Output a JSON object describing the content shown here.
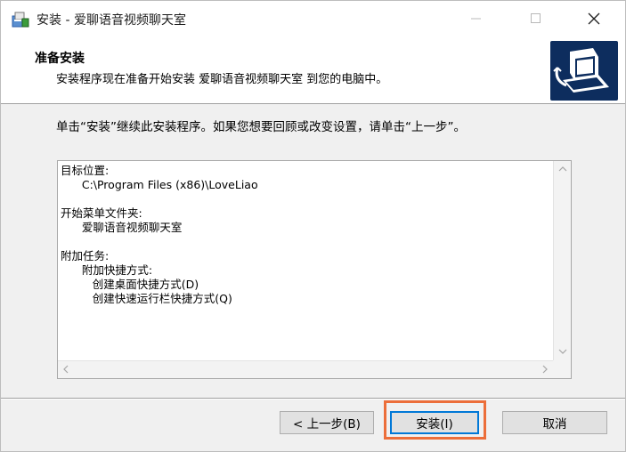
{
  "window": {
    "title": "安装 - 爱聊语音视频聊天室"
  },
  "header": {
    "title": "准备安装",
    "subtitle": "安装程序现在准备开始安装 爱聊语音视频聊天室 到您的电脑中。"
  },
  "body": {
    "instruction": "单击“安装”继续此安装程序。如果您想要回顾或改变设置，请单击“上一步”。",
    "memo_lines": [
      "目标位置:",
      "      C:\\Program Files (x86)\\LoveLiao",
      "",
      "开始菜单文件夹:",
      "      爱聊语音视频聊天室",
      "",
      "附加任务:",
      "      附加快捷方式:",
      "         创建桌面快捷方式(D)",
      "         创建快速运行栏快捷方式(Q)"
    ]
  },
  "buttons": {
    "back": "< 上一步(B)",
    "install": "安装(I)",
    "cancel": "取消"
  },
  "colors": {
    "highlight": "#ec6e3a",
    "focus": "#0078d7",
    "logo_bg": "#0d2d5e"
  },
  "icons": {
    "app": "installer-icon",
    "logo": "computer-install-icon"
  }
}
